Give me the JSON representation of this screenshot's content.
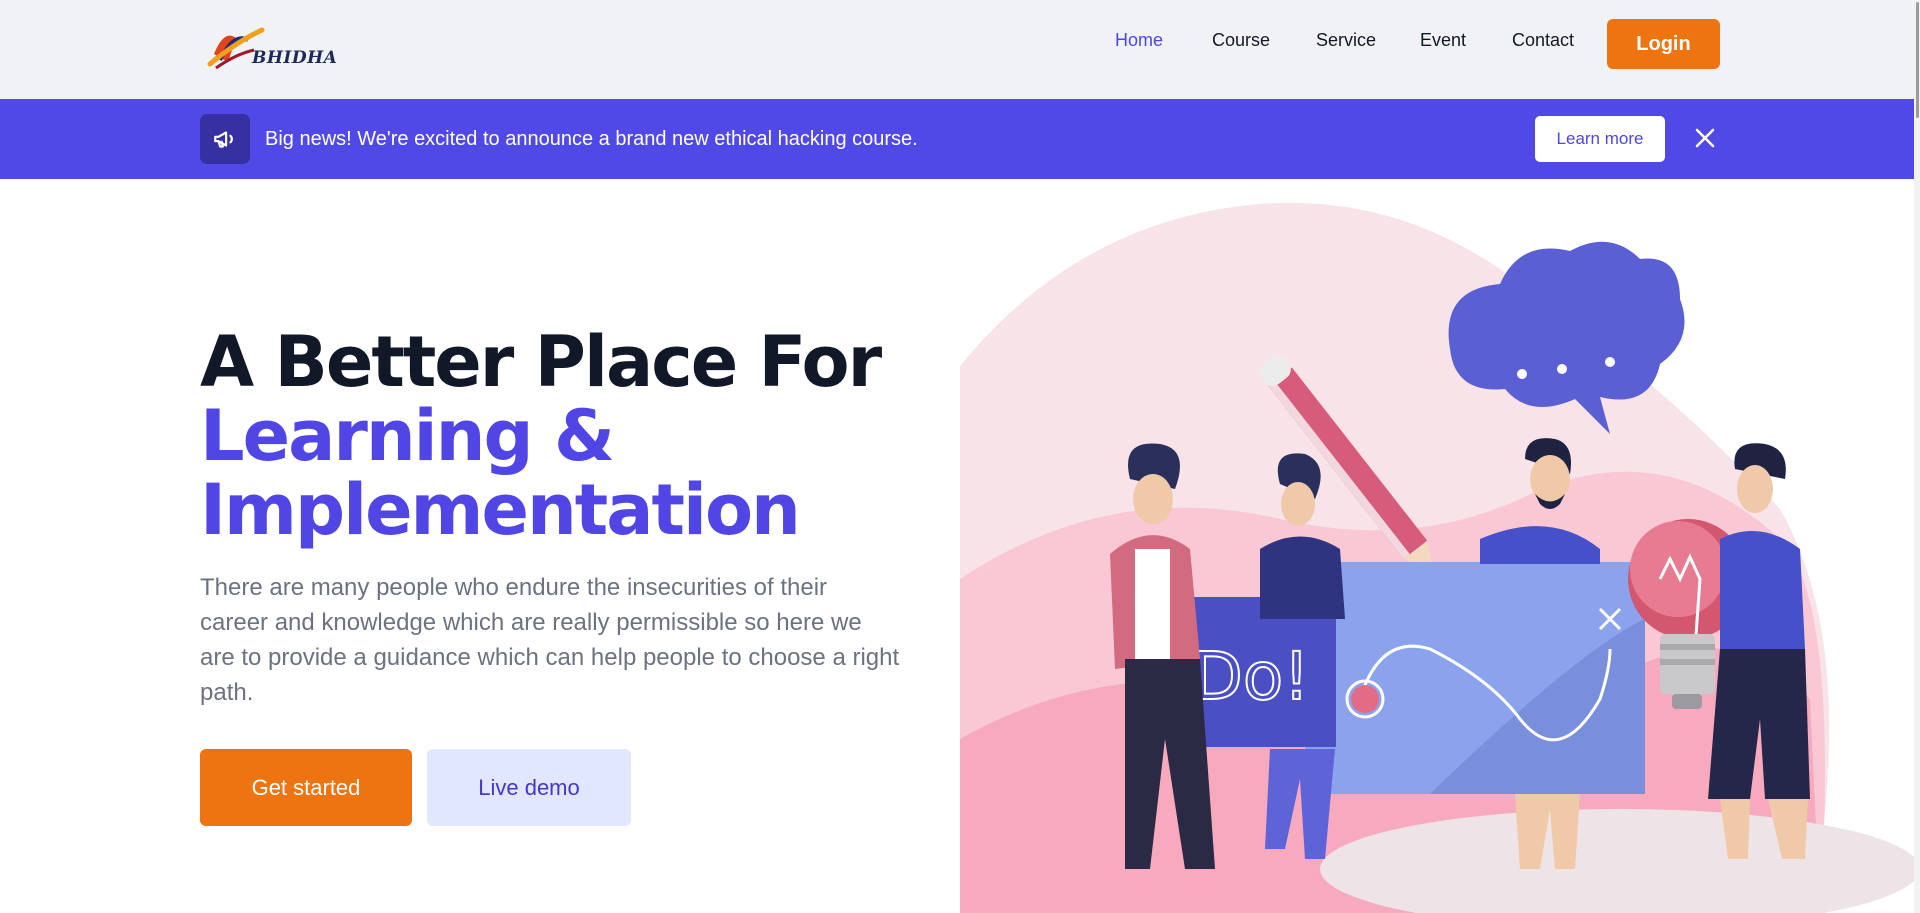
{
  "header": {
    "logo_text": "BHIDHA",
    "nav": [
      {
        "label": "Home",
        "active": true
      },
      {
        "label": "Course",
        "active": false
      },
      {
        "label": "Service",
        "active": false
      },
      {
        "label": "Event",
        "active": false
      },
      {
        "label": "Contact",
        "active": false
      }
    ],
    "login_label": "Login"
  },
  "banner": {
    "icon": "megaphone-icon",
    "text": "Big news! We're excited to announce a brand new ethical hacking course.",
    "cta_label": "Learn more",
    "close_icon": "close-icon"
  },
  "hero": {
    "title_line1": "A Better Place For",
    "title_line2a": "Learning &",
    "title_line2b": "Implementation",
    "description": "There are many people who endure the insecurities of their career and knowledge which are really permissible so here we are to provide a guidance which can help people to choose a right path.",
    "primary_button": "Get started",
    "secondary_button": "Live demo"
  },
  "illustration": {
    "board_text": "Do!"
  },
  "colors": {
    "accent": "#4f46e5",
    "banner": "#5049e5",
    "orange": "#ee7411",
    "header_bg": "#f0f2f6"
  }
}
